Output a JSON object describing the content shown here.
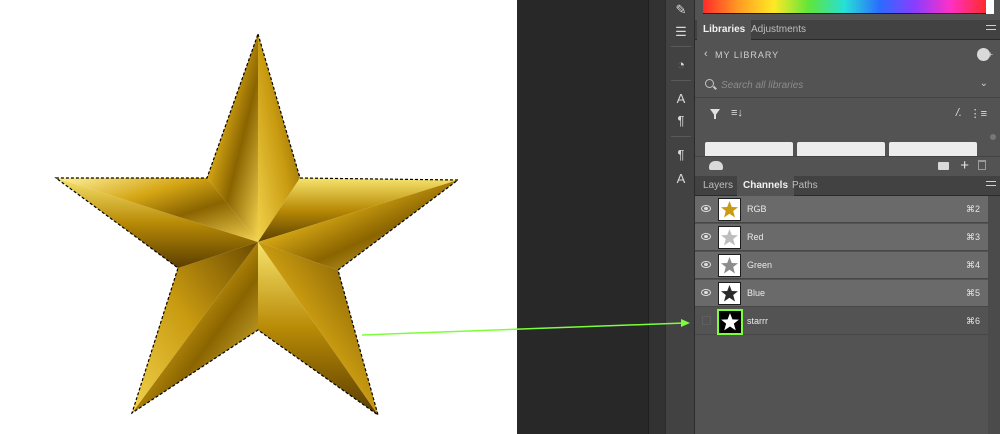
{
  "panels": {
    "top_tabs": [
      "Libraries",
      "Adjustments"
    ],
    "library": {
      "title": "MY LIBRARY",
      "search_placeholder": "Search all libraries"
    },
    "bottom_tabs": [
      "Layers",
      "Channels",
      "Paths"
    ],
    "channels": [
      {
        "name": "RGB",
        "shortcut": "⌘2",
        "visible": true,
        "thumb": "color"
      },
      {
        "name": "Red",
        "shortcut": "⌘3",
        "visible": true,
        "thumb": "gray-light"
      },
      {
        "name": "Green",
        "shortcut": "⌘4",
        "visible": true,
        "thumb": "gray-mid"
      },
      {
        "name": "Blue",
        "shortcut": "⌘5",
        "visible": true,
        "thumb": "gray-dark"
      },
      {
        "name": "starrr",
        "shortcut": "⌘6",
        "visible": false,
        "thumb": "mask"
      }
    ]
  },
  "colors": {
    "arrow": "#7cff3a",
    "panel_bg": "#535353",
    "selected_row": "#6a6a6a"
  },
  "icons": [
    "brush-icon",
    "sliders-icon",
    "history-icon",
    "type-icon",
    "paragraph-icon",
    "paragraph-style-icon",
    "character-style-icon"
  ]
}
